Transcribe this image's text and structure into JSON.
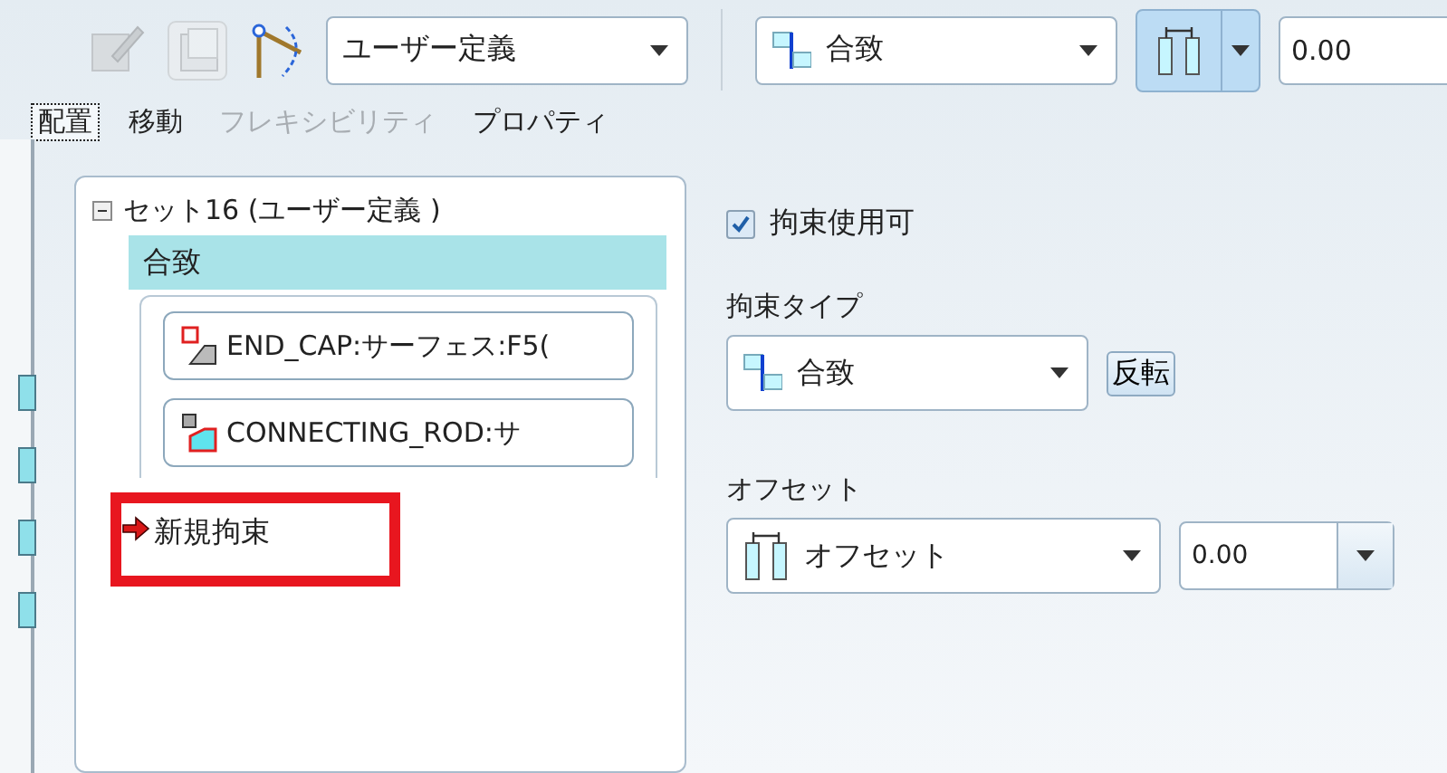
{
  "toolbar": {
    "icons": [
      {
        "kind": "sketch",
        "disabled": true
      },
      {
        "kind": "copy",
        "disabled": true
      },
      {
        "kind": "arc",
        "disabled": false
      }
    ],
    "set_type": {
      "value": "ユーザー定義"
    },
    "constraint_type": {
      "value": "合致"
    },
    "offset_type": {
      "selected": true
    },
    "offset_value": {
      "value": "0.00"
    }
  },
  "tabs": [
    {
      "label": "配置",
      "selected": true,
      "disabled": false
    },
    {
      "label": "移動",
      "selected": false,
      "disabled": false
    },
    {
      "label": "フレキシビリティ",
      "selected": false,
      "disabled": true
    },
    {
      "label": "プロパティ",
      "selected": false,
      "disabled": false
    }
  ],
  "constraint_set": {
    "label": "セット16 (ユーザー定義 )",
    "expanded": true,
    "constraints": [
      {
        "kind": "constraint",
        "label": "合致",
        "selected": true,
        "references": [
          {
            "label": "END_CAP:サーフェス:F5("
          },
          {
            "label": "CONNECTING_ROD:サ"
          }
        ]
      },
      {
        "kind": "new",
        "label": "新規拘束",
        "selected": false,
        "highlighted": true
      }
    ]
  },
  "properties": {
    "enabled": {
      "label": "拘束使用可",
      "checked": true
    },
    "type_label": "拘束タイプ",
    "type_value": "合致",
    "flip_button": "反転",
    "offset_label": "オフセット",
    "offset_type": "オフセット",
    "offset_value": "0.00"
  }
}
